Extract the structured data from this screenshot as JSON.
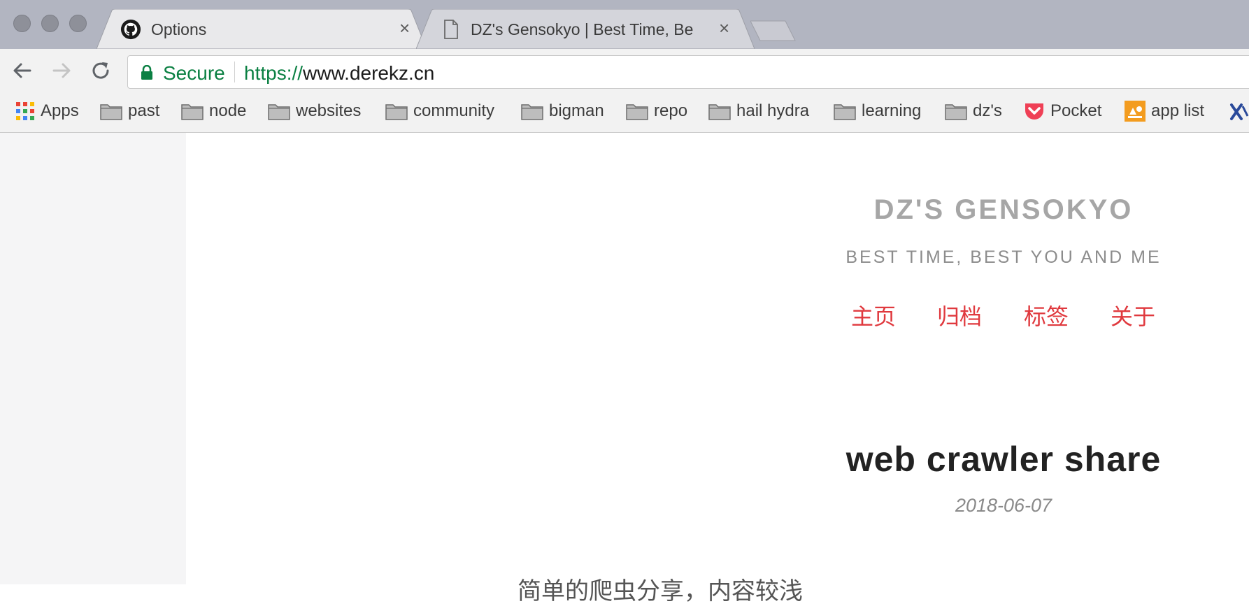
{
  "browser": {
    "tabs": [
      {
        "title": "Options",
        "icon": "github-icon",
        "close": "×"
      },
      {
        "title": "DZ's Gensokyo | Best Time, Be",
        "icon": "page-icon",
        "close": "×"
      }
    ],
    "address": {
      "secure_label": "Secure",
      "url_scheme": "https://",
      "url_host": "www.derekz.cn"
    },
    "bookmarks": [
      {
        "label": "Apps",
        "icon": "apps-grid-icon"
      },
      {
        "label": "past",
        "icon": "folder-icon"
      },
      {
        "label": "node",
        "icon": "folder-icon"
      },
      {
        "label": "websites",
        "icon": "folder-icon"
      },
      {
        "label": "community",
        "icon": "folder-icon"
      },
      {
        "label": "bigman",
        "icon": "folder-icon"
      },
      {
        "label": "repo",
        "icon": "folder-icon"
      },
      {
        "label": "hail hydra",
        "icon": "folder-icon"
      },
      {
        "label": "learning",
        "icon": "folder-icon"
      },
      {
        "label": "dz's",
        "icon": "folder-icon"
      },
      {
        "label": "Pocket",
        "icon": "pocket-icon"
      },
      {
        "label": "app list",
        "icon": "app-list-icon"
      }
    ],
    "colors": {
      "secure": "#0b8043",
      "tabstrip": "#b2b5c1",
      "toolbar": "#f2f2f2"
    }
  },
  "site": {
    "title": "DZ'S GENSOKYO",
    "subtitle": "BEST TIME, BEST YOU AND ME",
    "nav": [
      "主页",
      "归档",
      "标签",
      "关于"
    ],
    "accent_color": "#e0393e"
  },
  "post": {
    "title": "web crawler share",
    "date": "2018-06-07",
    "excerpt": "简单的爬虫分享，内容较浅"
  }
}
